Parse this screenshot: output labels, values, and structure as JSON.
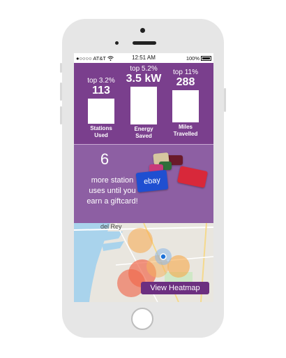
{
  "status_bar": {
    "carrier": "AT&T",
    "time": "12:51 AM",
    "battery": "100%"
  },
  "stats": [
    {
      "rank": "top 3.2%",
      "value": "113",
      "label_line1": "Stations",
      "label_line2": "Used"
    },
    {
      "rank": "top 5.2%",
      "value": "3.5 kW",
      "label_line1": "Energy",
      "label_line2": "Saved"
    },
    {
      "rank": "top 11%",
      "value": "288",
      "label_line1": "Miles",
      "label_line2": "Travelled"
    }
  ],
  "gift": {
    "count": "6",
    "line1": "more station",
    "line2": "uses until you",
    "line3": "earn a giftcard!",
    "ebay_card": "ebay"
  },
  "map": {
    "place_label": "del Rey",
    "heatmap_button": "View Heatmap"
  },
  "colors": {
    "stats_panel": "#7a3f8d",
    "gift_panel": "#8d5fa3",
    "button": "#6c2f80"
  }
}
